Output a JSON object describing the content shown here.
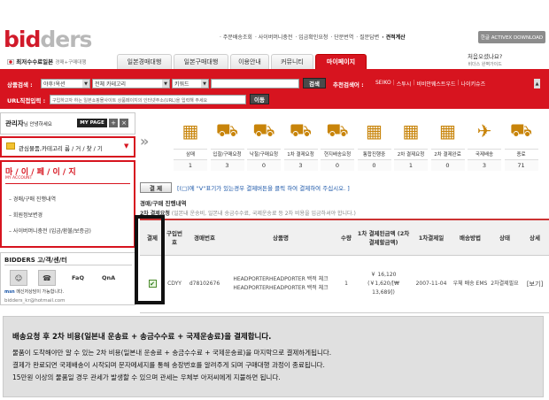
{
  "logo": {
    "part1": "bid",
    "part2": "ders"
  },
  "topnav": [
    "주문배송조회",
    "사이버머니충전",
    "입금확인요청",
    "단문번역",
    "질문답변",
    "견적계산"
  ],
  "activex": "한글 ACTIVEX DOWNLOAD",
  "promo": {
    "main": "최저수수료일본",
    "sub": "경매+구매대행"
  },
  "main_tabs": [
    "일본경매대행",
    "일본구매대행",
    "이용안내",
    "커뮤니티",
    "마이페이지"
  ],
  "active_tab_index": 4,
  "first_visit": {
    "line1": "처음오셨나요?",
    "line2": "비더스 완벽가이드"
  },
  "search": {
    "label": "상품검색 :",
    "site_select": "야후!옥션",
    "category_select": "전체 카테고리",
    "keyword_select": "키워드",
    "button": "검색"
  },
  "recommend": {
    "label": "추천검색어 :",
    "words": [
      "SEIKO",
      "스투시",
      "비비안웨스트우드",
      "나이키슈즈"
    ]
  },
  "url_search": {
    "label": "URL직접입력 :",
    "placeholder": "구입하고자 하는 일본쇼핑몰사이트 상품페이지의 인터넷주소(URL)을 입력해 주세요",
    "button": "이동"
  },
  "left_panel": {
    "title": "관리자",
    "title_sub": "님 안녕하세요",
    "mypage_btn": "MY PAGE",
    "favorites": "관심물품,카테고리 룸 / 거 / 찾 / 기",
    "mypage_title": "마 / 이 / 페 / 이 / 지",
    "mypage_sub": "MY ACCOUNT",
    "menu": [
      "경매/구매 진행내역",
      "회원정보변경",
      "사이버머니충전 (입금/환불/보증금)"
    ],
    "cs_title": "BIDDERS 고/객/센/터",
    "cs_items": [
      "FaQ",
      "QnA"
    ],
    "msn_label": "메신저상담이 가능합니다.",
    "msn_email": "bidders_kr@hotmail.com"
  },
  "steps": [
    {
      "label": "삼매",
      "count": "1"
    },
    {
      "label": "입찰/구매요청",
      "count": "3"
    },
    {
      "label": "낙찰/구매요청",
      "count": "0"
    },
    {
      "label": "1차 결제요청",
      "count": "3"
    },
    {
      "label": "현지배송요청",
      "count": "0"
    },
    {
      "label": "통합진행중",
      "count": "0"
    },
    {
      "label": "2차 결제요청",
      "count": "1"
    },
    {
      "label": "2차 결제완료",
      "count": "0"
    },
    {
      "label": "국제배송",
      "count": "3"
    },
    {
      "label": "종료",
      "count": "71"
    }
  ],
  "payment": {
    "button": "결 제",
    "note": "[(□)에 \"V\"표기가 있는경우 결제버튼을 클릭 하여 결제하여 주십시오. ]"
  },
  "section": {
    "title": "경매/구매 진행내역",
    "sub_title": "2차 결제요청",
    "sub_note": "(일본내 운송비, 일본내 송금수수료, 국제운송료 등 2차 비용을 입금하셔야 합니다.)"
  },
  "table": {
    "headers": [
      "결제",
      "구입번호",
      "경매번호",
      "상품명",
      "수량",
      "1차 결제된금액 (2차 결제할금액)",
      "1차결제일",
      "배송방법",
      "상태",
      "상세"
    ],
    "rows": [
      {
        "checked": true,
        "order_no": "CDYY",
        "auction_no": "d78102676",
        "product": "HEADPORTERHEADPORTER 백적 체크 HEADPORTERHEADPORTER 백적 체크",
        "qty": "1",
        "amount1": "￥ 16,120",
        "amount2": "(￥1,620/[₩ 13,689])",
        "date": "2007-11-04",
        "shipping": "우체 배송 EMS",
        "status": "2차결제필요",
        "detail": "[보기]"
      }
    ]
  },
  "info": {
    "title": "배송요청 후 2차 비용(일본내 운송료 + 송금수수료 + 국제운송료)을 결제합니다.",
    "lines": [
      "물품이 도착해야만 알 수 있는 2차 비용(일본내 운송료 + 송금수수료 + 국제운송료)을 마지막으로 결제하게됩니다.",
      "결제가 완료되면 국제배송이 시작되며 문자메세지를 통해 송장번호를 알려주게 되며 구매대행 과정이 종료됩니다.",
      "15만원 이상의 물품일 경우 관세가 발생할 수 있으며 관세는 우체부 아저씨에게 지불하면 됩니다."
    ]
  },
  "colors": {
    "brand_red": "#d7141f",
    "link_blue": "#1a56a8",
    "info_bg": "#e0e0e0"
  }
}
